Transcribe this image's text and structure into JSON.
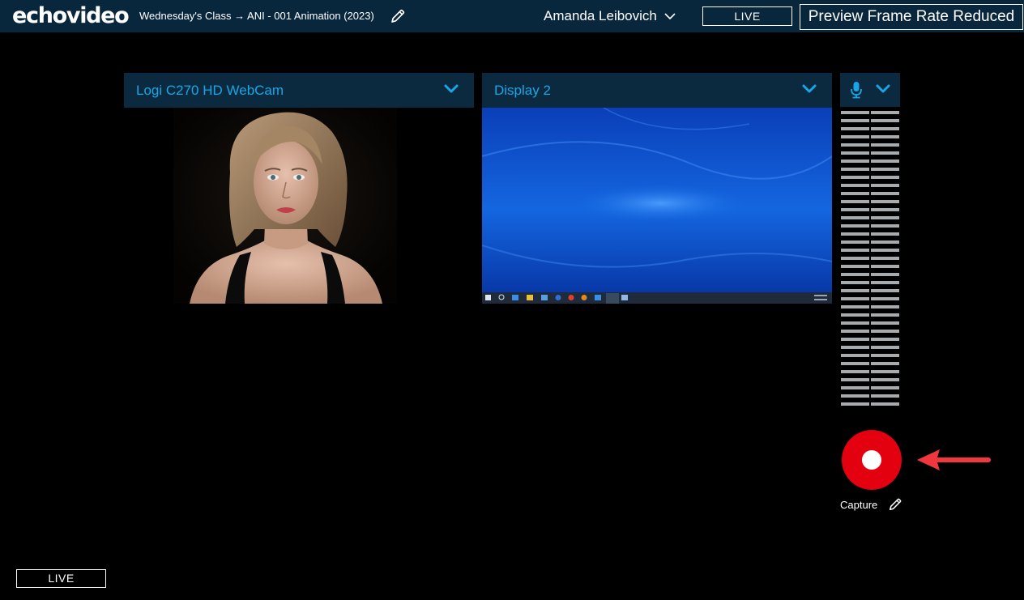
{
  "header": {
    "logo": "echovideo",
    "breadcrumb": "Wednesday's Class → ANI - 001 Animation (2023)",
    "user_name": "Amanda Leibovich",
    "live_label": "LIVE",
    "notice": "Preview Frame Rate Reduced"
  },
  "sources": {
    "camera": {
      "label": "Logi C270 HD WebCam",
      "icon": "chevron-down-icon"
    },
    "display": {
      "label": "Display 2",
      "icon": "chevron-down-icon"
    }
  },
  "audio": {
    "icon": "microphone-icon",
    "meter_segments": 37,
    "level": 0
  },
  "capture": {
    "label": "Capture",
    "icon": "pencil-icon"
  },
  "footer": {
    "live_label": "LIVE"
  },
  "colors": {
    "topbar": "#08263c",
    "panel_header": "#0b2a3f",
    "accent": "#18a6e6",
    "record": "#e3000f",
    "arrow": "#f0373f",
    "meter": "#a8abae"
  }
}
